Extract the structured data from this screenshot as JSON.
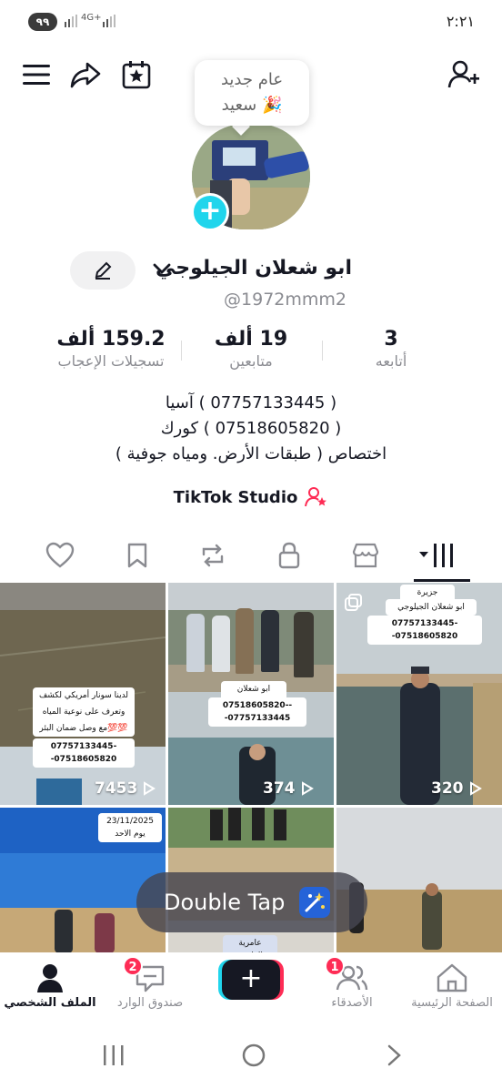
{
  "status_bar": {
    "battery": "٩٩",
    "signal_text": "4G+",
    "time": "٢:٢١"
  },
  "bubble": {
    "line1": "عام جديد",
    "line2": "سعيد 🎉"
  },
  "profile": {
    "display_name": "ابو شعلان الجيلوجي",
    "handle": "@1972mmm2"
  },
  "stats": {
    "following": {
      "value": "3",
      "label": "أتابعه"
    },
    "followers": {
      "value": "19 ألف",
      "label": "متابعين"
    },
    "likes": {
      "value": "159.2 ألف",
      "label": "تسجيلات الإعجاب"
    }
  },
  "bio": {
    "line1": "( 07757133445 ) آسيا",
    "line2": "( 07518605820 ) كورك",
    "line3": "اختصاص ( طبقات الأرض. ومياه جوفية )"
  },
  "studio_label": "TikTok Studio",
  "videos": [
    {
      "views": "7453",
      "caption_lines": [
        "لدينا سونار أمريكي لكشف المياه الجوفية",
        "وتعرف على نوعية المياه الصالحه للزراعة",
        "مع وصل ضمان البئر💯💯",
        "07757133445--07518605820"
      ]
    },
    {
      "views": "374",
      "caption_lines": [
        "ابو شعلان الجيلوجي",
        "07518605820---07757133445"
      ]
    },
    {
      "views": "320",
      "caption_lines": [
        "جزيرة سامراء",
        "ابو شعلان الجيلوجي",
        "07757133445--07518605820"
      ]
    },
    {
      "date_caption": "23/11/2025 يوم الاحد"
    },
    {
      "caption_lines": [
        "عامرية الفلوجة"
      ]
    },
    {}
  ],
  "overlay": {
    "double_tap": "Double Tap"
  },
  "bottom_nav": {
    "home": "الصفحة الرئيسية",
    "friends": "الأصدقاء",
    "friends_badge": "1",
    "create": "+",
    "inbox": "صندوق الوارد",
    "inbox_badge": "2",
    "profile": "الملف الشخصي"
  },
  "colors": {
    "accent": "#fe2c55",
    "cyan": "#20d5ec",
    "text": "#161823",
    "muted": "#8a8b91"
  }
}
